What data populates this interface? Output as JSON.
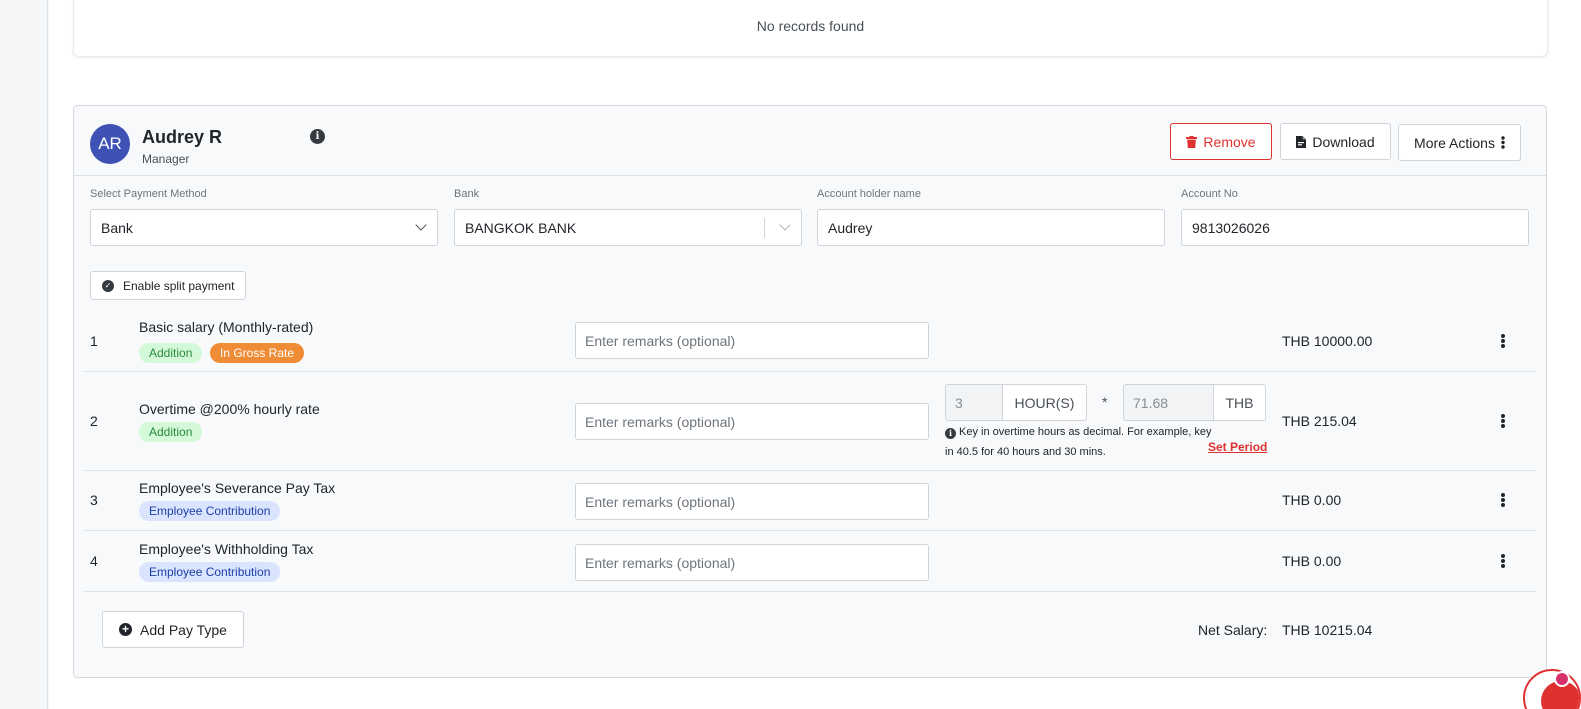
{
  "empty_state": {
    "message": "No records found"
  },
  "employee": {
    "initials": "AR",
    "name": "Audrey R",
    "role": "Manager",
    "actions": {
      "remove": "Remove",
      "download": "Download",
      "more": "More Actions"
    }
  },
  "payment": {
    "method_label": "Select Payment Method",
    "method_value": "Bank",
    "bank_label": "Bank",
    "bank_value": "BANGKOK BANK",
    "holder_label": "Account holder name",
    "holder_value": "Audrey",
    "account_label": "Account No",
    "account_value": "9813026026",
    "split_label": "Enable split payment"
  },
  "remarks_placeholder": "Enter remarks (optional)",
  "pay_items": [
    {
      "num": "1",
      "title": "Basic salary (Monthly-rated)",
      "badges": [
        "Addition",
        "In Gross Rate"
      ],
      "amount": "THB 10000.00"
    },
    {
      "num": "2",
      "title": "Overtime @200% hourly rate",
      "badges": [
        "Addition"
      ],
      "amount": "THB 215.04",
      "overtime": {
        "hours": "3",
        "hours_unit": "HOUR(S)",
        "multiplier": "*",
        "rate": "71.68",
        "rate_unit": "THB",
        "help": "Key in overtime hours as decimal. For example, key in 40.5 for 40 hours and 30 mins.",
        "set_period": "Set Period"
      }
    },
    {
      "num": "3",
      "title": "Employee's Severance Pay Tax",
      "badges": [
        "Employee Contribution"
      ],
      "amount": "THB 0.00"
    },
    {
      "num": "4",
      "title": "Employee's Withholding Tax",
      "badges": [
        "Employee Contribution"
      ],
      "amount": "THB 0.00"
    }
  ],
  "footer": {
    "add_pay_type": "Add Pay Type",
    "net_label": "Net Salary:",
    "net_value": "THB 10215.04"
  },
  "colors": {
    "accent_red": "#e03131",
    "avatar_blue": "#3f51b5",
    "gross_orange": "#f08c35",
    "addition_green": "#2b8a3e",
    "contribution_blue": "#1c3fa8"
  }
}
